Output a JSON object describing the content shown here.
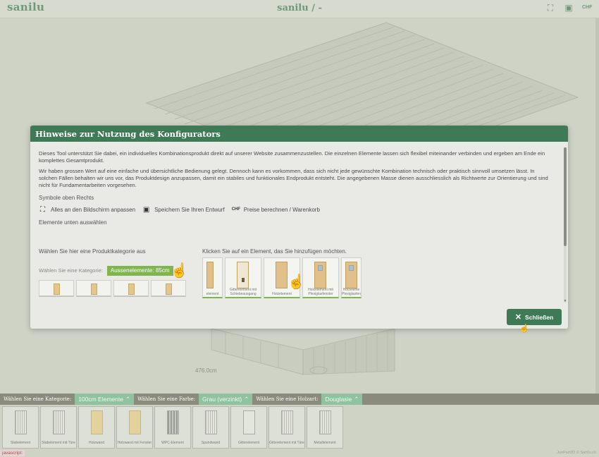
{
  "header": {
    "logo": "sanilu",
    "title": "sanilu / -"
  },
  "scene": {
    "dimension_label": "476.0cm"
  },
  "modal": {
    "title": "Hinweise zur Nutzung des Konfigurators",
    "para1": "Dieses Tool unterstützt Sie dabei, ein individuelles Kombinationsprodukt direkt auf unserer Website zusammenzustellen. Die einzelnen Elemente lassen sich flexibel miteinander verbinden und ergeben am Ende ein komplettes Gesamtprodukt.",
    "para2": "Wir haben grossen Wert auf eine einfache und übersichtliche Bedienung gelegt. Dennoch kann es vorkommen, dass sich nicht jede gewünschte Kombination technisch oder praktisch sinnvoll umsetzen lässt. In solchen Fällen behalten wir uns vor, das Produktdesign anzupassen, damit ein stabiles und funktionales Endprodukt entsteht. Die angegebenen Masse dienen ausschliesslich als Richtwerte zur Orientierung und sind nicht für Fundamentarbeiten vorgesehen.",
    "symbols_heading": "Symbole oben Rechts",
    "symbol_fit": "Alles an den Bildschirm anpassen",
    "symbol_save": "Speichern Sie Ihren Entwurf",
    "symbol_price": "Preise berechnen / Warenkorb",
    "elements_heading": "Elemente unten auswählen",
    "choose_category_title": "Wählen Sie hier eine Produktkategorie aus",
    "choose_category_label": "Wählen Sie eine Kategorie:",
    "choose_category_value": "Aussenelemente: 85cm",
    "click_element_title": "Klicken Sie auf ein Element, das Sie hinzufügen möchten.",
    "demo_elements": [
      "element",
      "Gitterelement mit Schiebeausgang",
      "Holzelement",
      "Holzelement mit Plexiglasfenster",
      "Holzeleme Plexiglasfen"
    ],
    "close_label": "Schließen"
  },
  "filters": {
    "category_label": "Wählen Sie eine Kategorie:",
    "category_value": "100cm Elemente",
    "color_label": "Wählen Sie eine Farbe:",
    "color_value": "Grau (verzinkt)",
    "wood_label": "Wählen Sie eine Holzart:",
    "wood_value": "Douglasie"
  },
  "products": [
    "Stabelement",
    "Stabelement mit Türe",
    "Holzwand",
    "Holzwand mit Fenster",
    "WPC-Element",
    "Spundwand",
    "Gitterelement",
    "Gitterelement mit Türe",
    "Metallelement"
  ],
  "status": {
    "js": "javascript:",
    "copyright": "JuoPart3D © Sanilu.ch"
  },
  "colors": {
    "primary": "#3f7a57",
    "accent": "#7fb54c",
    "filter_value": "#8fc3a0"
  }
}
